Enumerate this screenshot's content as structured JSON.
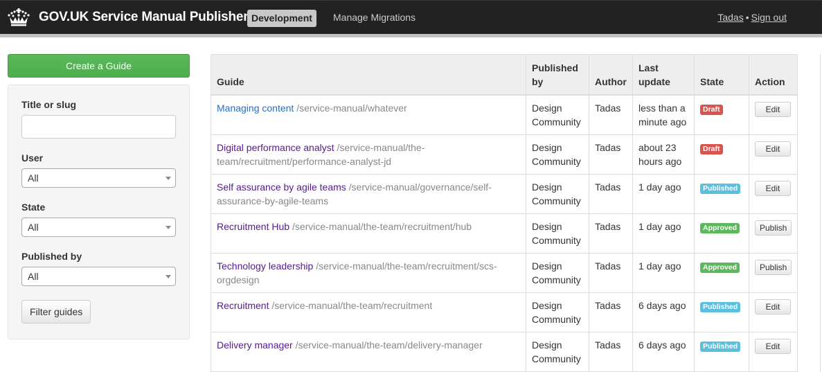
{
  "header": {
    "brand": "GOV.UK Service Manual Publisher",
    "environment": "Development",
    "nav_link": "Manage Migrations",
    "user_name": "Tadas",
    "separator": "•",
    "sign_out": "Sign out",
    "logo_icon": "crown-icon"
  },
  "sidebar": {
    "create_button": "Create a Guide",
    "filters": {
      "title_label": "Title or slug",
      "title_value": "",
      "user_label": "User",
      "user_value": "All",
      "state_label": "State",
      "state_value": "All",
      "published_by_label": "Published by",
      "published_by_value": "All",
      "submit": "Filter guides"
    }
  },
  "table": {
    "columns": [
      "Guide",
      "Published by",
      "Author",
      "Last update",
      "State",
      "Action"
    ],
    "rows": [
      {
        "title": "Managing content",
        "slug": "/service-manual/whatever",
        "published_by": "Design Community",
        "author": "Tadas",
        "updated": "less than a minute ago",
        "state": "Draft",
        "action": "Edit"
      },
      {
        "title": "Digital performance analyst",
        "slug": "/service-manual/the-team/recruitment/performance-analyst-jd",
        "published_by": "Design Community",
        "author": "Tadas",
        "updated": "about 23 hours ago",
        "state": "Draft",
        "action": "Edit"
      },
      {
        "title": "Self assurance by agile teams",
        "slug": "/service-manual/governance/self-assurance-by-agile-teams",
        "published_by": "Design Community",
        "author": "Tadas",
        "updated": "1 day ago",
        "state": "Published",
        "action": "Edit"
      },
      {
        "title": "Recruitment Hub",
        "slug": "/service-manual/the-team/recruitment/hub",
        "published_by": "Design Community",
        "author": "Tadas",
        "updated": "1 day ago",
        "state": "Approved",
        "action": "Publish"
      },
      {
        "title": "Technology leadership",
        "slug": "/service-manual/the-team/recruitment/scs-orgdesign",
        "published_by": "Design Community",
        "author": "Tadas",
        "updated": "1 day ago",
        "state": "Approved",
        "action": "Publish"
      },
      {
        "title": "Recruitment",
        "slug": "/service-manual/the-team/recruitment",
        "published_by": "Design Community",
        "author": "Tadas",
        "updated": "6 days ago",
        "state": "Published",
        "action": "Edit"
      },
      {
        "title": "Delivery manager",
        "slug": "/service-manual/the-team/delivery-manager",
        "published_by": "Design Community",
        "author": "Tadas",
        "updated": "6 days ago",
        "state": "Published",
        "action": "Edit"
      }
    ]
  },
  "colors": {
    "header_bg": "#222222",
    "primary_green": "#5cb85c",
    "draft": "#d9534f",
    "published": "#5bc0de",
    "approved": "#5cb85c",
    "visited_link": "#551a8b",
    "link": "#2b6fb6"
  }
}
